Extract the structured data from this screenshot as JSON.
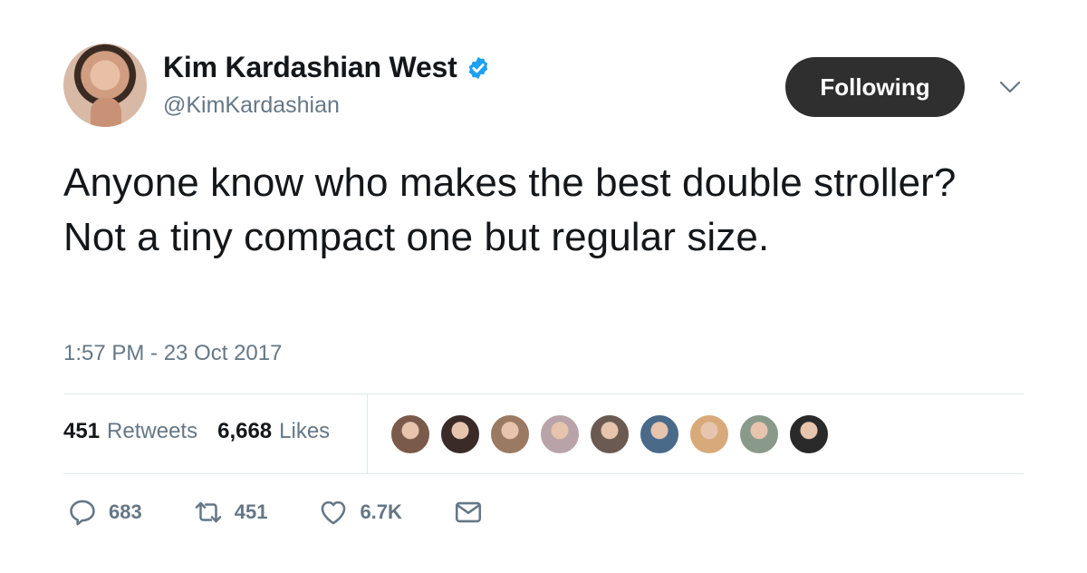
{
  "author": {
    "display_name": "Kim Kardashian West",
    "handle": "@KimKardashian",
    "verified": true
  },
  "follow_button_label": "Following",
  "tweet": {
    "text": "Anyone know who makes the best double stroller? Not a tiny compact one but regular size.",
    "timestamp": "1:57 PM - 23 Oct 2017"
  },
  "stats": {
    "retweets_count": "451",
    "retweets_label": "Retweets",
    "likes_count": "6,668",
    "likes_label": "Likes"
  },
  "actions": {
    "reply_count": "683",
    "retweet_count": "451",
    "like_count": "6.7K"
  },
  "colors": {
    "text_primary": "#14171a",
    "text_secondary": "#657786",
    "verified_blue": "#1da1f2",
    "button_bg": "#2f2f2f",
    "divider": "#e1e8ed"
  },
  "liker_avatars": [
    {
      "color": "#7a5a4a"
    },
    {
      "color": "#3a2a28"
    },
    {
      "color": "#9a7a62"
    },
    {
      "color": "#b8a4a8"
    },
    {
      "color": "#6a5a52"
    },
    {
      "color": "#4a6a8a"
    },
    {
      "color": "#d8aa7a"
    },
    {
      "color": "#8a9a8a"
    },
    {
      "color": "#2a2a2a"
    }
  ]
}
